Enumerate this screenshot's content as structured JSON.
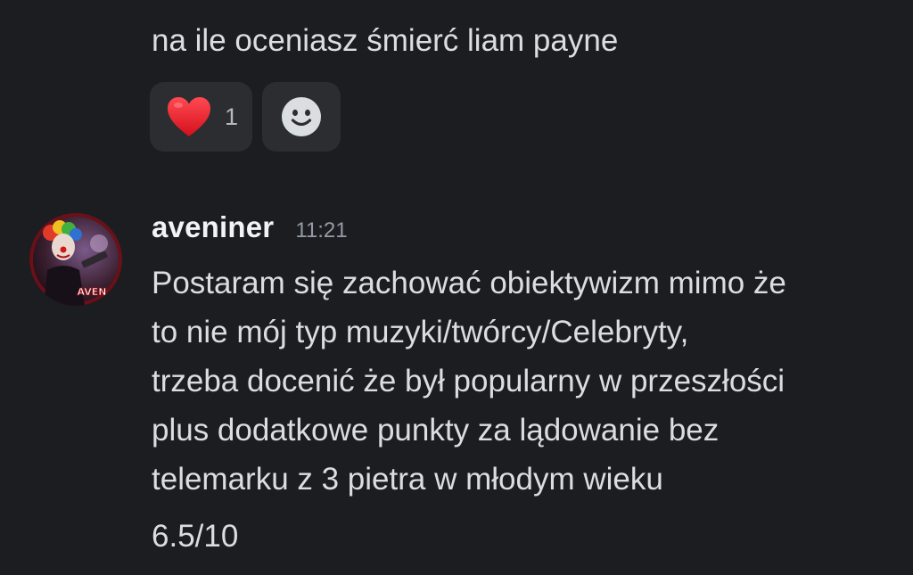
{
  "previous_message": {
    "text": "na ile oceniasz śmierć liam payne"
  },
  "reactions": [
    {
      "icon": "heart-icon",
      "color": "#e8202b",
      "count": "1"
    },
    {
      "icon": "add-reaction-icon",
      "color": "#dbdee1"
    }
  ],
  "message": {
    "username": "aveniner",
    "timestamp": "11:21",
    "avatar_text": "AVEN",
    "lines": [
      "Postaram się zachować obiektywizm mimo że",
      "to nie mój typ muzyki/twórcy/Celebryty,",
      "trzeba docenić że był popularny w przeszłości",
      "plus dodatkowe punkty za lądowanie bez",
      "telemarku z 3 pietra w młodym wieku"
    ],
    "rating": "6.5/10"
  },
  "colors": {
    "background": "#1c1d21",
    "reaction_bg": "#2b2d31",
    "text": "#dbdee1",
    "username": "#f2f3f5",
    "timestamp": "#949ba4"
  }
}
